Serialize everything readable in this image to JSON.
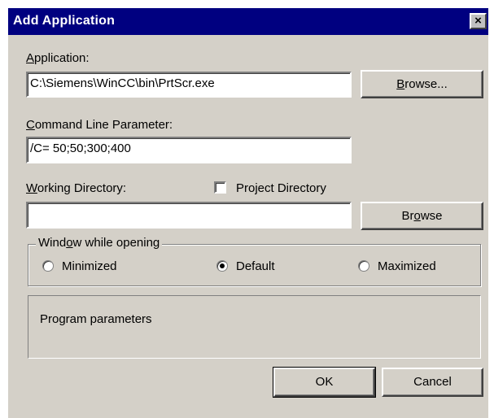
{
  "window": {
    "title": "Add Application",
    "close_glyph": "×"
  },
  "application": {
    "label_hotkey": "A",
    "label_rest": "pplication:",
    "value": "C:\\Siemens\\WinCC\\bin\\PrtScr.exe",
    "browse_pre": "",
    "browse_hotkey": "B",
    "browse_rest": "rowse..."
  },
  "command_line": {
    "label_hotkey": "C",
    "label_rest": "ommand Line Parameter:",
    "value": "/C= 50;50;300;400"
  },
  "working_directory": {
    "label_hotkey": "W",
    "label_rest": "orking Directory:",
    "value": "",
    "browse_pre": "Br",
    "browse_hotkey": "o",
    "browse_rest": "wse"
  },
  "project_directory": {
    "label": "Project Directory",
    "checked": false
  },
  "window_group": {
    "legend_pre": "Wind",
    "legend_hotkey": "o",
    "legend_rest": "w while opening",
    "options": [
      {
        "label": "Minimized",
        "selected": false
      },
      {
        "label": "Default",
        "selected": true
      },
      {
        "label": "Maximized",
        "selected": false
      }
    ]
  },
  "parameters_panel": {
    "text": "Program parameters"
  },
  "buttons": {
    "ok_label": "OK",
    "cancel_label": "Cancel"
  },
  "colors": {
    "titlebar": "#000080",
    "dialog_face": "#d4d0c8",
    "field_background": "#ffffff"
  }
}
